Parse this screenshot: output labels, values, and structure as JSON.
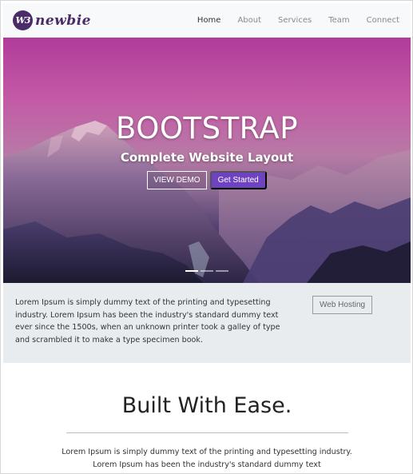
{
  "navbar": {
    "brand_badge": "W3",
    "brand_text": "newbie",
    "links": [
      {
        "label": "Home",
        "active": true
      },
      {
        "label": "About",
        "active": false
      },
      {
        "label": "Services",
        "active": false
      },
      {
        "label": "Team",
        "active": false
      },
      {
        "label": "Connect",
        "active": false
      }
    ]
  },
  "hero": {
    "title": "BOOTSTRAP",
    "subtitle": "Complete Website Layout",
    "view_demo_label": "VIEW DEMO",
    "get_started_label": "Get Started",
    "slide_count": 3,
    "active_slide": 0
  },
  "info": {
    "text": "Lorem Ipsum is simply dummy text of the printing and typesetting industry. Lorem Ipsum has been the industry's standard dummy text ever since the 1500s, when an unknown printer took a galley of type and scrambled it to make a type specimen book.",
    "button_label": "Web Hosting"
  },
  "ease": {
    "title": "Built With Ease.",
    "text": "Lorem Ipsum is simply dummy text of the printing and typesetting industry. Lorem Ipsum has been the industry's standard dummy text"
  },
  "colors": {
    "brand": "#4b2c68",
    "primary": "#6f42c1",
    "navbar_bg": "#f8f9fa",
    "info_bg": "#e9ecef"
  }
}
